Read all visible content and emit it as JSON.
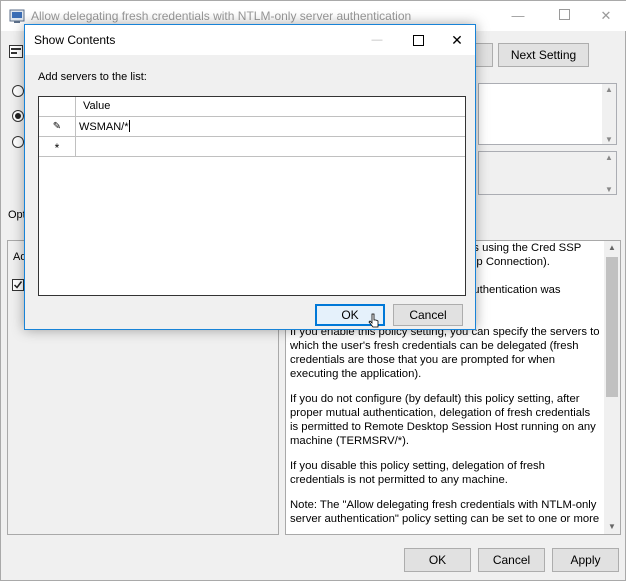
{
  "main": {
    "title": "Allow delegating fresh credentials with NTLM-only server authentication",
    "next_setting": "Next Setting",
    "options_label": "Opt",
    "add_label": "Ad",
    "help_text": [
      "ns using the Cred SSP",
      "top Connection).",
      "authentication was",
      "If you enable this policy setting, you can specify the servers to which the user's fresh credentials can be delegated (fresh credentials are those that you are prompted for when executing the application).",
      "If you do not configure (by default) this policy setting, after proper mutual authentication, delegation of fresh credentials is permitted to Remote Desktop Session Host running on any machine (TERMSRV/*).",
      "If you disable this policy setting, delegation of fresh credentials is not permitted to any machine.",
      "Note: The \"Allow delegating fresh credentials with NTLM-only server authentication\" policy setting can be set to one or more"
    ],
    "ok": "OK",
    "cancel": "Cancel",
    "apply": "Apply"
  },
  "dialog": {
    "title": "Show Contents",
    "instruction": "Add servers to the list:",
    "column_header": "Value",
    "rows": [
      "WSMAN/*",
      ""
    ],
    "ok": "OK",
    "cancel": "Cancel"
  }
}
